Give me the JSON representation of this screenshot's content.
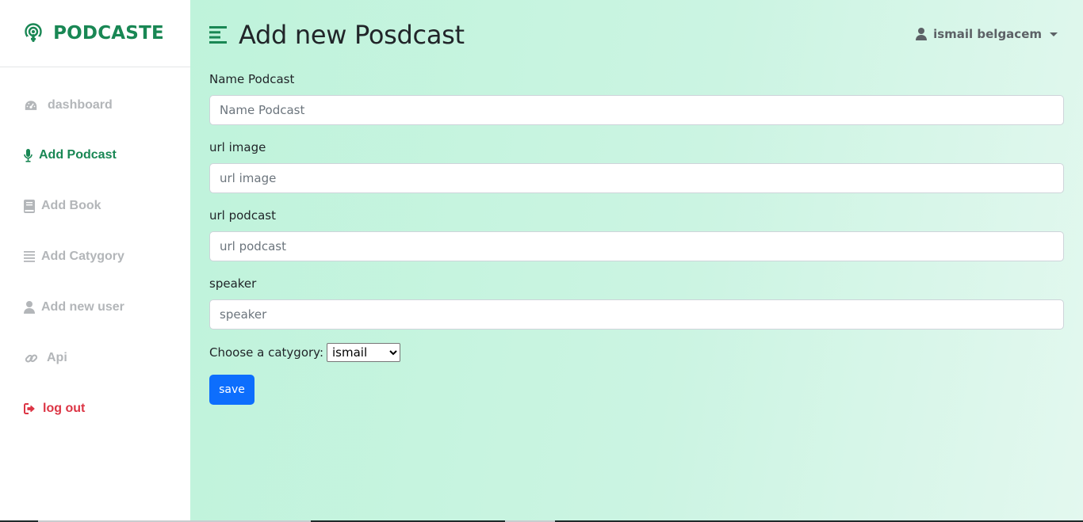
{
  "brand": {
    "name": "PODCASTE",
    "icon": "podcast-icon",
    "color": "#198754"
  },
  "sidebar": {
    "items": [
      {
        "label": "dashboard",
        "icon": "gauge-icon",
        "state": "inactive"
      },
      {
        "label": "Add Podcast",
        "icon": "microphone-icon",
        "state": "active"
      },
      {
        "label": "Add Book",
        "icon": "book-icon",
        "state": "inactive"
      },
      {
        "label": "Add Catygory",
        "icon": "list-icon",
        "state": "inactive"
      },
      {
        "label": "Add new user",
        "icon": "user-icon",
        "state": "inactive"
      },
      {
        "label": "Api",
        "icon": "link-icon",
        "state": "inactive"
      },
      {
        "label": "log out",
        "icon": "sign-out-icon",
        "state": "danger"
      }
    ]
  },
  "header": {
    "title": "Add new Posdcast",
    "user": "ismail belgacem"
  },
  "form": {
    "fields": [
      {
        "label": "Name Podcast",
        "placeholder": "Name Podcast",
        "value": ""
      },
      {
        "label": "url image",
        "placeholder": "url image",
        "value": ""
      },
      {
        "label": "url podcast",
        "placeholder": "url podcast",
        "value": ""
      },
      {
        "label": "speaker",
        "placeholder": "speaker",
        "value": ""
      }
    ],
    "category": {
      "label": "Choose a catygory:",
      "selected": "ismail"
    },
    "save_label": "save"
  },
  "colors": {
    "accent": "#198754",
    "danger": "#dc3545",
    "primary_button": "#0d6efd",
    "main_bg_start": "#bff3db",
    "main_bg_end": "#e3f8ef"
  }
}
